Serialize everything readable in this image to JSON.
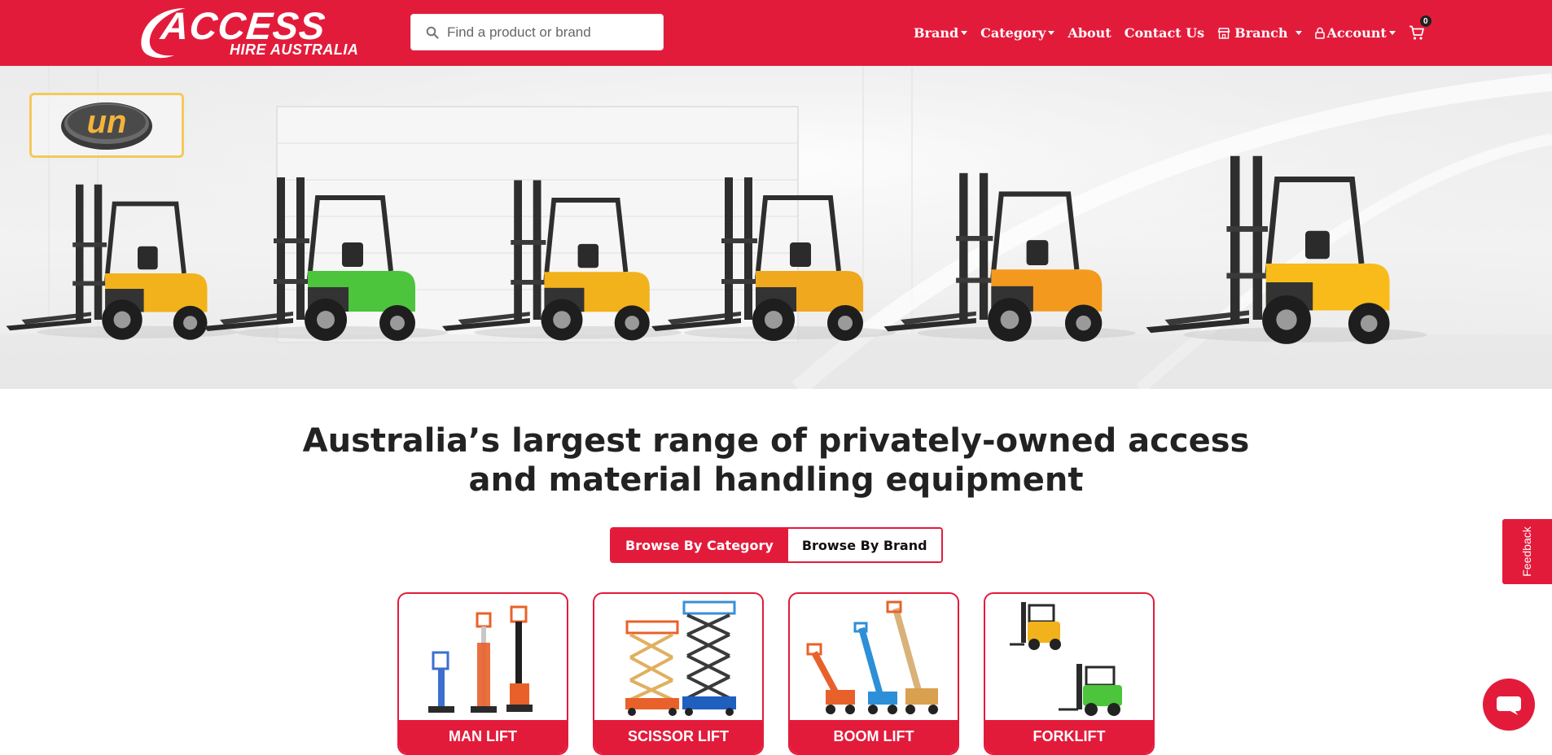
{
  "header": {
    "logo": {
      "main": "ACCESS",
      "sub": "HIRE AUSTRALIA"
    },
    "search": {
      "placeholder": "Find a product or brand",
      "icon": "search-icon"
    },
    "nav": {
      "brand": "Brand",
      "category": "Category",
      "about": "About",
      "contact": "Contact Us",
      "branch": "Branch",
      "account": "Account",
      "cart_count": "0"
    }
  },
  "hero": {
    "brand_badge": "un",
    "forklift_colors": [
      "#f2b21b",
      "#4cc43c",
      "#f2b21b",
      "#f0a81e",
      "#f39a1e",
      "#f8bb1a"
    ]
  },
  "main": {
    "headline_line1": "Australia’s largest range of privately-owned access",
    "headline_line2": "and material handling equipment",
    "browse_tabs": {
      "category": "Browse By Category",
      "brand": "Browse By Brand",
      "active": "category"
    },
    "categories": [
      {
        "label": "MAN LIFT"
      },
      {
        "label": "SCISSOR LIFT"
      },
      {
        "label": "BOOM LIFT"
      },
      {
        "label": "FORKLIFT"
      }
    ]
  },
  "widgets": {
    "feedback": "Feedback",
    "chat_icon": "chat-bubble-icon"
  },
  "colors": {
    "brand_red": "#e31b3b",
    "badge_gold": "#f5c95a"
  }
}
